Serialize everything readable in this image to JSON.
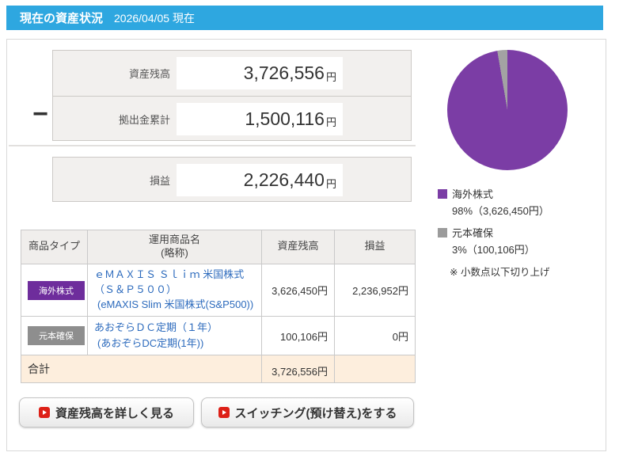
{
  "header": {
    "title": "現在の資産状況",
    "date": "2026/04/05 現在"
  },
  "summary": {
    "minus_sign": "−",
    "rows": [
      {
        "label": "資産残高",
        "value": "3,726,556",
        "unit": "円"
      },
      {
        "label": "拠出金累計",
        "value": "1,500,116",
        "unit": "円"
      }
    ],
    "profit": {
      "label": "損益",
      "value": "2,226,440",
      "unit": "円"
    }
  },
  "pie": {
    "segments": [
      {
        "label": "海外株式",
        "color": "#7b3da5",
        "pct": 97.3
      },
      {
        "label": "元本確保",
        "color": "#a3a3a3",
        "pct": 2.7
      }
    ],
    "legend": [
      {
        "name": "海外株式",
        "detail": "98%（3,626,450円）",
        "color": "#7b3da5"
      },
      {
        "name": "元本確保",
        "detail": "3%（100,106円）",
        "color": "#9b9b9b"
      }
    ],
    "note": "※ 小数点以下切り上げ"
  },
  "chart_data": {
    "type": "pie",
    "labels": [
      "海外株式",
      "元本確保"
    ],
    "values": [
      3626450,
      100106
    ],
    "percent_labels": [
      "98%",
      "3%"
    ],
    "colors": [
      "#7b3da5",
      "#9b9b9b"
    ],
    "note": "※ 小数点以下切り上げ"
  },
  "table": {
    "headers": {
      "type": "商品タイプ",
      "name_line1": "運用商品名",
      "name_line2": "(略称)",
      "balance": "資産残高",
      "pl": "損益"
    },
    "rows": [
      {
        "type": "海外株式",
        "type_color": "#6e2d9c",
        "name_line1": "ｅＭＡＸＩＳ Ｓｌｉｍ 米国株式（Ｓ＆Ｐ５００）",
        "name_line2": "(eMAXIS Slim 米国株式(S&P500))",
        "balance": "3,626,450円",
        "pl": "2,236,952円"
      },
      {
        "type": "元本確保",
        "type_color": "#8e8e8e",
        "name_line1": "あおぞらＤＣ定期（１年）",
        "name_line2": "(あおぞらDC定期(1年))",
        "balance": "100,106円",
        "pl": "0円"
      }
    ],
    "total": {
      "label": "合計",
      "balance": "3,726,556円",
      "pl": ""
    }
  },
  "buttons": [
    {
      "label": "資産残高を詳しく見る"
    },
    {
      "label": "スイッチング(預け替え)をする"
    }
  ]
}
